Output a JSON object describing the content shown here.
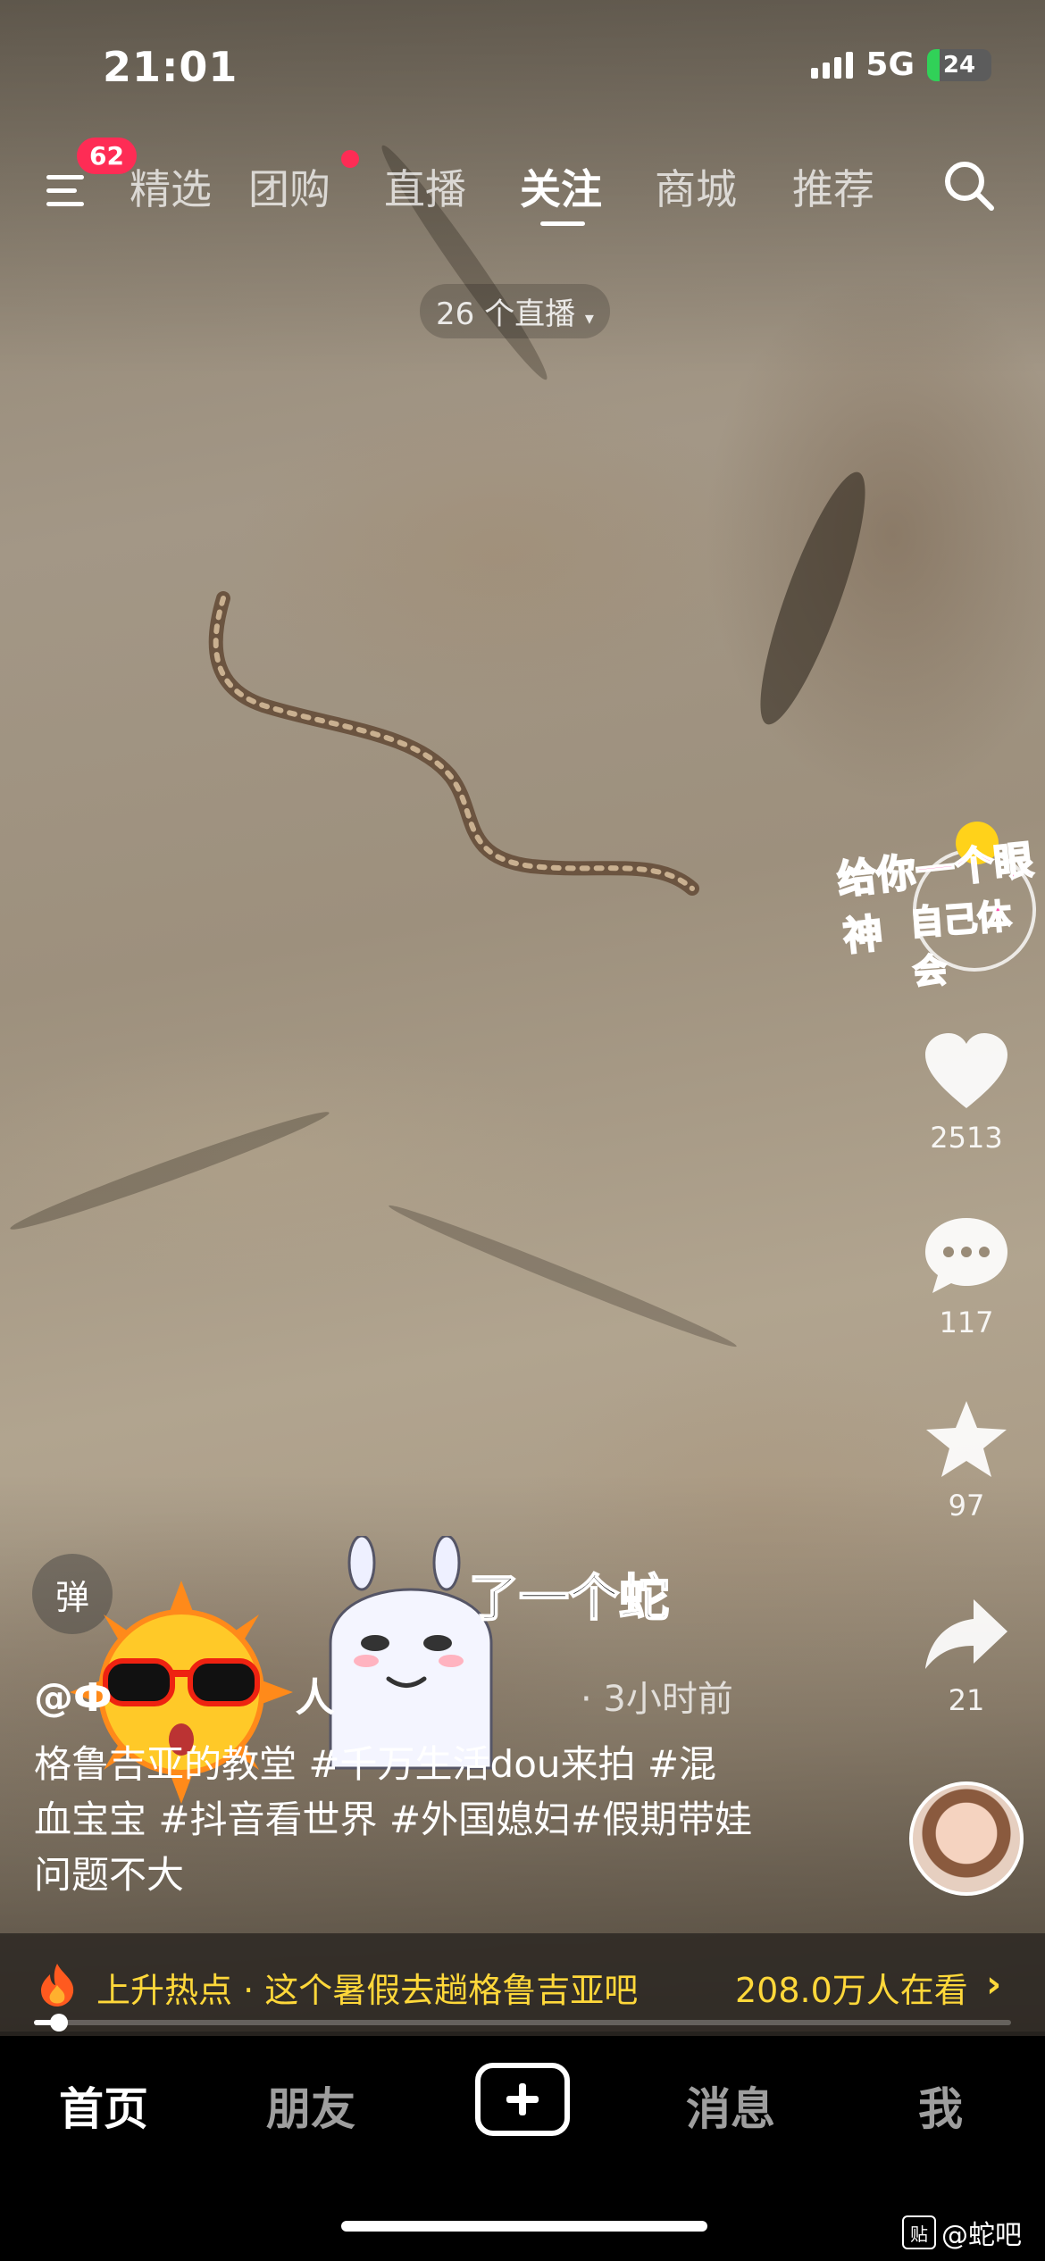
{
  "status_bar": {
    "time": "21:01",
    "network": "5G",
    "battery": "24"
  },
  "top_nav": {
    "menu_badge": "62",
    "tabs": [
      "精选",
      "团购",
      "直播",
      "关注",
      "商城",
      "推荐"
    ],
    "active_tab": "关注",
    "live_count": "26 个直播"
  },
  "right_rail": {
    "sticker_text_1": "给你一个眼神",
    "sticker_text_2": "自己体会",
    "like_count": "2513",
    "comment_count": "117",
    "favorite_count": "97",
    "share_count": "21"
  },
  "overlay": {
    "danmaku_button": "弹",
    "sticker_caption": "了一个蛇"
  },
  "post": {
    "author": "@Ф",
    "author_suffix": "人",
    "time_ago": "· 3小时前",
    "description_lines": [
      "格鲁吉亚的教堂 #千万生活dou来拍 #混",
      "血宝宝 #抖音看世界 #外国媳妇#假期带娃",
      "问题不大"
    ]
  },
  "hot_bar": {
    "label": "上升热点 · 这个暑假去趟格鲁吉亚吧",
    "watching": "208.0万人在看",
    "progress": 0.02
  },
  "bottom_tabs": {
    "home": "首页",
    "friends": "朋友",
    "messages": "消息",
    "me": "我",
    "active": "首页"
  },
  "watermark": {
    "icon_text": "贴",
    "text": "@蛇吧"
  },
  "colors": {
    "accent_red": "#fe2c55",
    "hot_yellow": "#ffd83a"
  }
}
